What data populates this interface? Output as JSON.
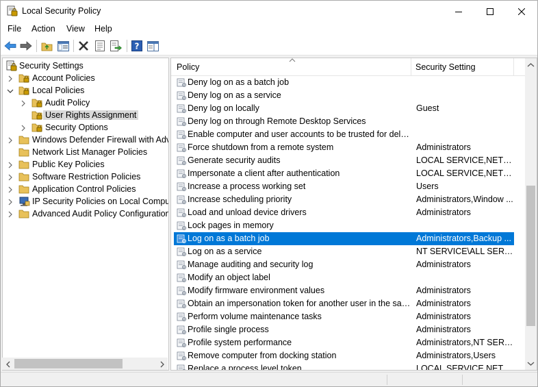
{
  "window": {
    "title": "Local Security Policy",
    "icon": "security-policy-icon"
  },
  "menu": [
    "File",
    "Action",
    "View",
    "Help"
  ],
  "toolbar": {
    "buttons": [
      "back-arrow-icon",
      "forward-arrow-icon",
      "up-folder-icon",
      "show-hide-tree-icon",
      "delete-icon",
      "properties-icon",
      "export-list-icon",
      "help-icon",
      "view-pane-icon"
    ]
  },
  "tree": {
    "items": [
      {
        "label": "Security Settings",
        "level": 0,
        "expander": "none",
        "icon": "security-settings-icon"
      },
      {
        "label": "Account Policies",
        "level": 1,
        "expander": "collapsed",
        "icon": "folder-lock-icon"
      },
      {
        "label": "Local Policies",
        "level": 1,
        "expander": "expanded",
        "icon": "folder-lock-icon"
      },
      {
        "label": "Audit Policy",
        "level": 2,
        "expander": "collapsed",
        "icon": "folder-lock-icon"
      },
      {
        "label": "User Rights Assignment",
        "level": 2,
        "expander": "none",
        "icon": "folder-lock-icon",
        "selected": true
      },
      {
        "label": "Security Options",
        "level": 2,
        "expander": "collapsed",
        "icon": "folder-lock-icon"
      },
      {
        "label": "Windows Defender Firewall with Adva",
        "level": 1,
        "expander": "collapsed",
        "icon": "folder-icon"
      },
      {
        "label": "Network List Manager Policies",
        "level": 1,
        "expander": "none",
        "icon": "folder-icon"
      },
      {
        "label": "Public Key Policies",
        "level": 1,
        "expander": "collapsed",
        "icon": "folder-icon"
      },
      {
        "label": "Software Restriction Policies",
        "level": 1,
        "expander": "collapsed",
        "icon": "folder-icon"
      },
      {
        "label": "Application Control Policies",
        "level": 1,
        "expander": "collapsed",
        "icon": "folder-icon"
      },
      {
        "label": "IP Security Policies on Local Compute",
        "level": 1,
        "expander": "collapsed",
        "icon": "ip-security-icon"
      },
      {
        "label": "Advanced Audit Policy Configuration",
        "level": 1,
        "expander": "collapsed",
        "icon": "folder-icon"
      }
    ]
  },
  "list": {
    "columns": [
      "Policy",
      "Security Setting"
    ],
    "rows": [
      {
        "policy": "Deny log on as a batch job",
        "setting": ""
      },
      {
        "policy": "Deny log on as a service",
        "setting": ""
      },
      {
        "policy": "Deny log on locally",
        "setting": "Guest"
      },
      {
        "policy": "Deny log on through Remote Desktop Services",
        "setting": ""
      },
      {
        "policy": "Enable computer and user accounts to be trusted for delega...",
        "setting": ""
      },
      {
        "policy": "Force shutdown from a remote system",
        "setting": "Administrators"
      },
      {
        "policy": "Generate security audits",
        "setting": "LOCAL SERVICE,NETWO..."
      },
      {
        "policy": "Impersonate a client after authentication",
        "setting": "LOCAL SERVICE,NETWO..."
      },
      {
        "policy": "Increase a process working set",
        "setting": "Users"
      },
      {
        "policy": "Increase scheduling priority",
        "setting": "Administrators,Window ..."
      },
      {
        "policy": "Load and unload device drivers",
        "setting": "Administrators"
      },
      {
        "policy": "Lock pages in memory",
        "setting": ""
      },
      {
        "policy": "Log on as a batch job",
        "setting": "Administrators,Backup ...",
        "selected": true
      },
      {
        "policy": "Log on as a service",
        "setting": "NT SERVICE\\ALL SERVICES"
      },
      {
        "policy": "Manage auditing and security log",
        "setting": "Administrators"
      },
      {
        "policy": "Modify an object label",
        "setting": ""
      },
      {
        "policy": "Modify firmware environment values",
        "setting": "Administrators"
      },
      {
        "policy": "Obtain an impersonation token for another user in the same...",
        "setting": "Administrators"
      },
      {
        "policy": "Perform volume maintenance tasks",
        "setting": "Administrators"
      },
      {
        "policy": "Profile single process",
        "setting": "Administrators"
      },
      {
        "policy": "Profile system performance",
        "setting": "Administrators,NT SERVI..."
      },
      {
        "policy": "Remove computer from docking station",
        "setting": "Administrators,Users"
      },
      {
        "policy": "Replace a process level token",
        "setting": "LOCAL SERVICE,NETWO..."
      }
    ]
  },
  "colors": {
    "selection": "#0078d7",
    "tree_selection": "#d9d9d9",
    "folder": "#e8c15a",
    "lock": "#d9a300"
  }
}
